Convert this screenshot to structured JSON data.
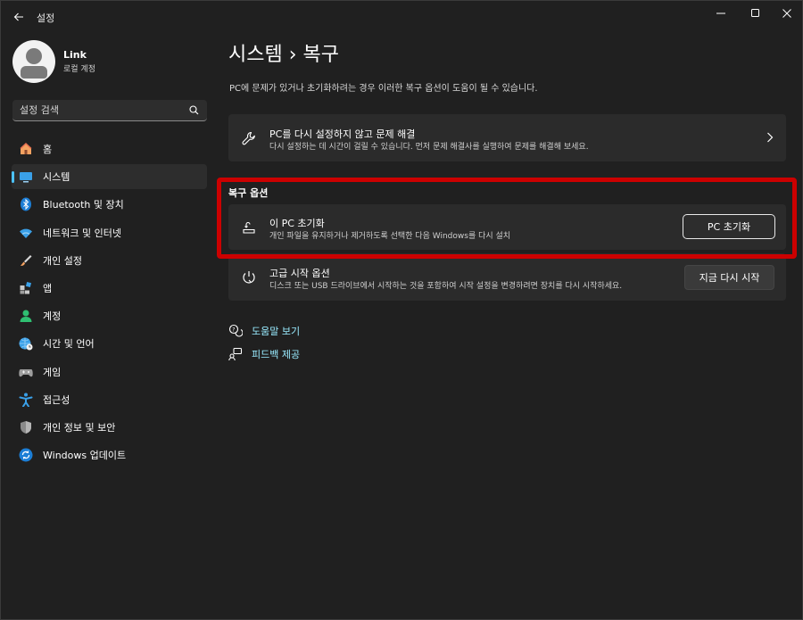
{
  "window": {
    "title": "설정"
  },
  "profile": {
    "name": "Link",
    "account_type": "로컬 계정"
  },
  "search": {
    "placeholder": "설정 검색"
  },
  "sidebar": {
    "items": [
      {
        "label": "홈",
        "icon": "home-icon"
      },
      {
        "label": "시스템",
        "icon": "system-icon",
        "active": true
      },
      {
        "label": "Bluetooth 및 장치",
        "icon": "bluetooth-icon"
      },
      {
        "label": "네트워크 및 인터넷",
        "icon": "wifi-icon"
      },
      {
        "label": "개인 설정",
        "icon": "brush-icon"
      },
      {
        "label": "앱",
        "icon": "apps-icon"
      },
      {
        "label": "계정",
        "icon": "account-icon"
      },
      {
        "label": "시간 및 언어",
        "icon": "globe-clock-icon"
      },
      {
        "label": "게임",
        "icon": "gamepad-icon"
      },
      {
        "label": "접근성",
        "icon": "accessibility-icon"
      },
      {
        "label": "개인 정보 및 보안",
        "icon": "shield-icon"
      },
      {
        "label": "Windows 업데이트",
        "icon": "update-icon"
      }
    ]
  },
  "main": {
    "breadcrumb": "시스템  ›  복구",
    "description": "PC에 문제가 있거나 초기화하려는 경우 이러한 복구 옵션이 도움이 될 수 있습니다.",
    "troubleshoot": {
      "title": "PC를 다시 설정하지 않고 문제 해결",
      "subtitle": "다시 설정하는 데 시간이 걸릴 수 있습니다. 먼저 문제 해결사를 실행하여 문제를 해결해 보세요."
    },
    "section_label": "복구 옵션",
    "reset": {
      "title": "이 PC 초기화",
      "subtitle": "개인 파일을 유지하거나 제거하도록 선택한 다음 Windows를 다시 설치",
      "button": "PC 초기화"
    },
    "advanced": {
      "title": "고급 시작 옵션",
      "subtitle": "디스크 또는 USB 드라이브에서 시작하는 것을 포함하여 시작 설정을 변경하려면 장치를 다시 시작하세요.",
      "button": "지금 다시 시작"
    },
    "links": {
      "help": "도움말 보기",
      "feedback": "피드백 제공"
    }
  },
  "colors": {
    "accent": "#4cc2ff",
    "link": "#99ebff",
    "highlight": "#cc0000",
    "background": "#202020"
  }
}
